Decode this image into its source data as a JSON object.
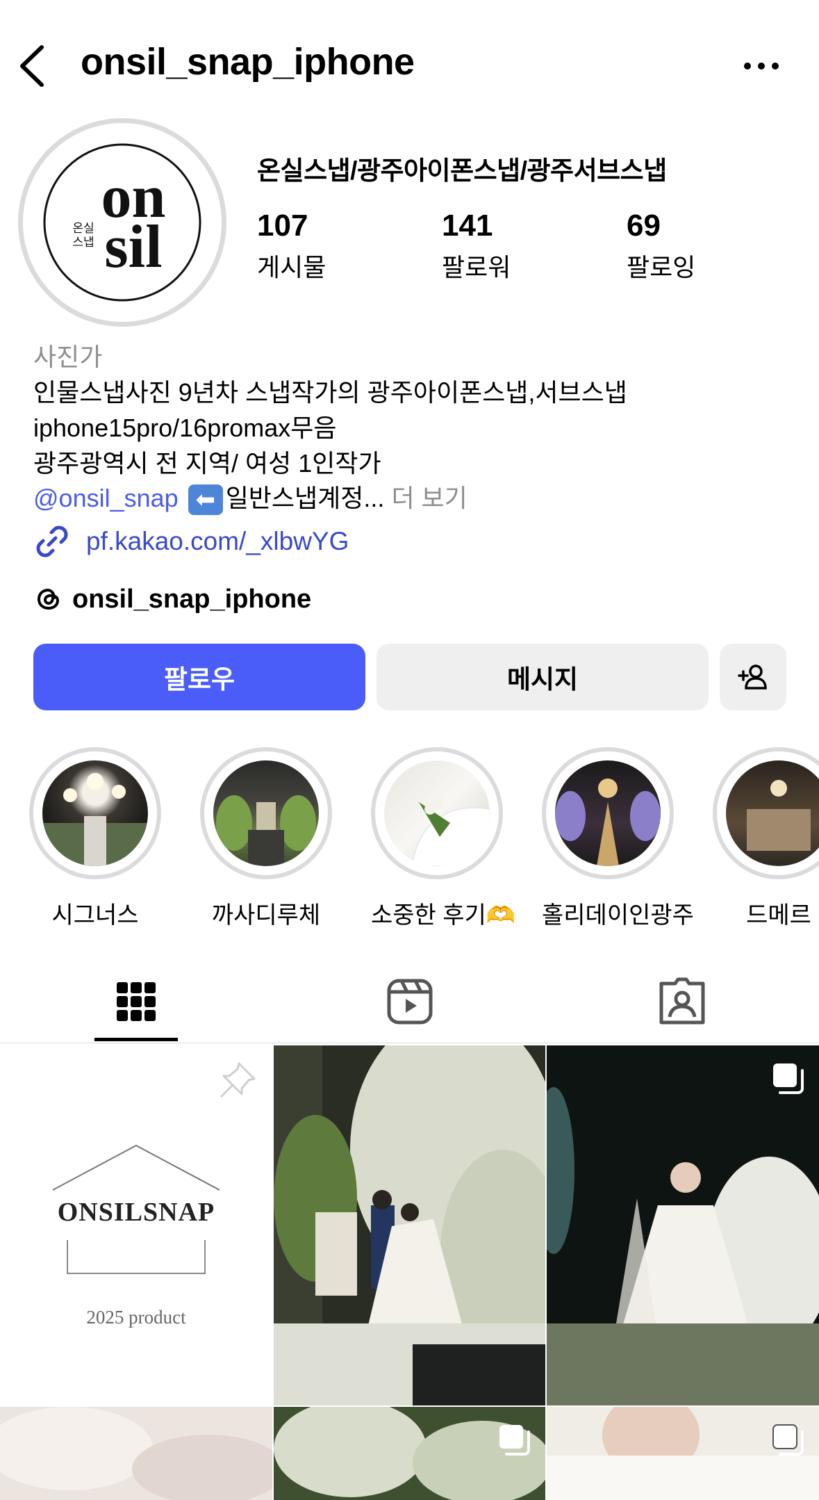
{
  "header": {
    "username": "onsil_snap_iphone"
  },
  "profile": {
    "display_name": "온실스냅/광주아이폰스냅/광주서브스냅",
    "avatar_text_main": "onsil",
    "avatar_text_sub": "온실\n스냅",
    "stats": [
      {
        "number": "107",
        "label": "게시물"
      },
      {
        "number": "141",
        "label": "팔로워"
      },
      {
        "number": "69",
        "label": "팔로잉"
      }
    ],
    "category": "사진가",
    "bio_lines": [
      "인물스냅사진 9년차 스냅작가의 광주아이폰스냅,서브스냅",
      "iphone15pro/16promax무음",
      "광주광역시 전 지역/ 여성 1인작가"
    ],
    "bio_mention": "@onsil_snap",
    "bio_after_mention": "일반스냅계정...",
    "bio_more": "더 보기",
    "link": "pf.kakao.com/_xlbwYG",
    "threads_handle": "onsil_snap_iphone"
  },
  "buttons": {
    "follow": "팔로우",
    "message": "메시지"
  },
  "highlights": [
    {
      "label": "시그너스"
    },
    {
      "label": "까사디루체"
    },
    {
      "label": "소중한 후기🫶"
    },
    {
      "label": "홀리데이인광주"
    },
    {
      "label": "드메르"
    }
  ],
  "grid": {
    "pinned_post": {
      "title": "ONSILSNAP",
      "subtitle": "2025 product"
    }
  },
  "colors": {
    "accent": "#4a5df9",
    "link": "#3a49c9",
    "divider": "#dbdbdb",
    "button_bg": "#efefef"
  }
}
